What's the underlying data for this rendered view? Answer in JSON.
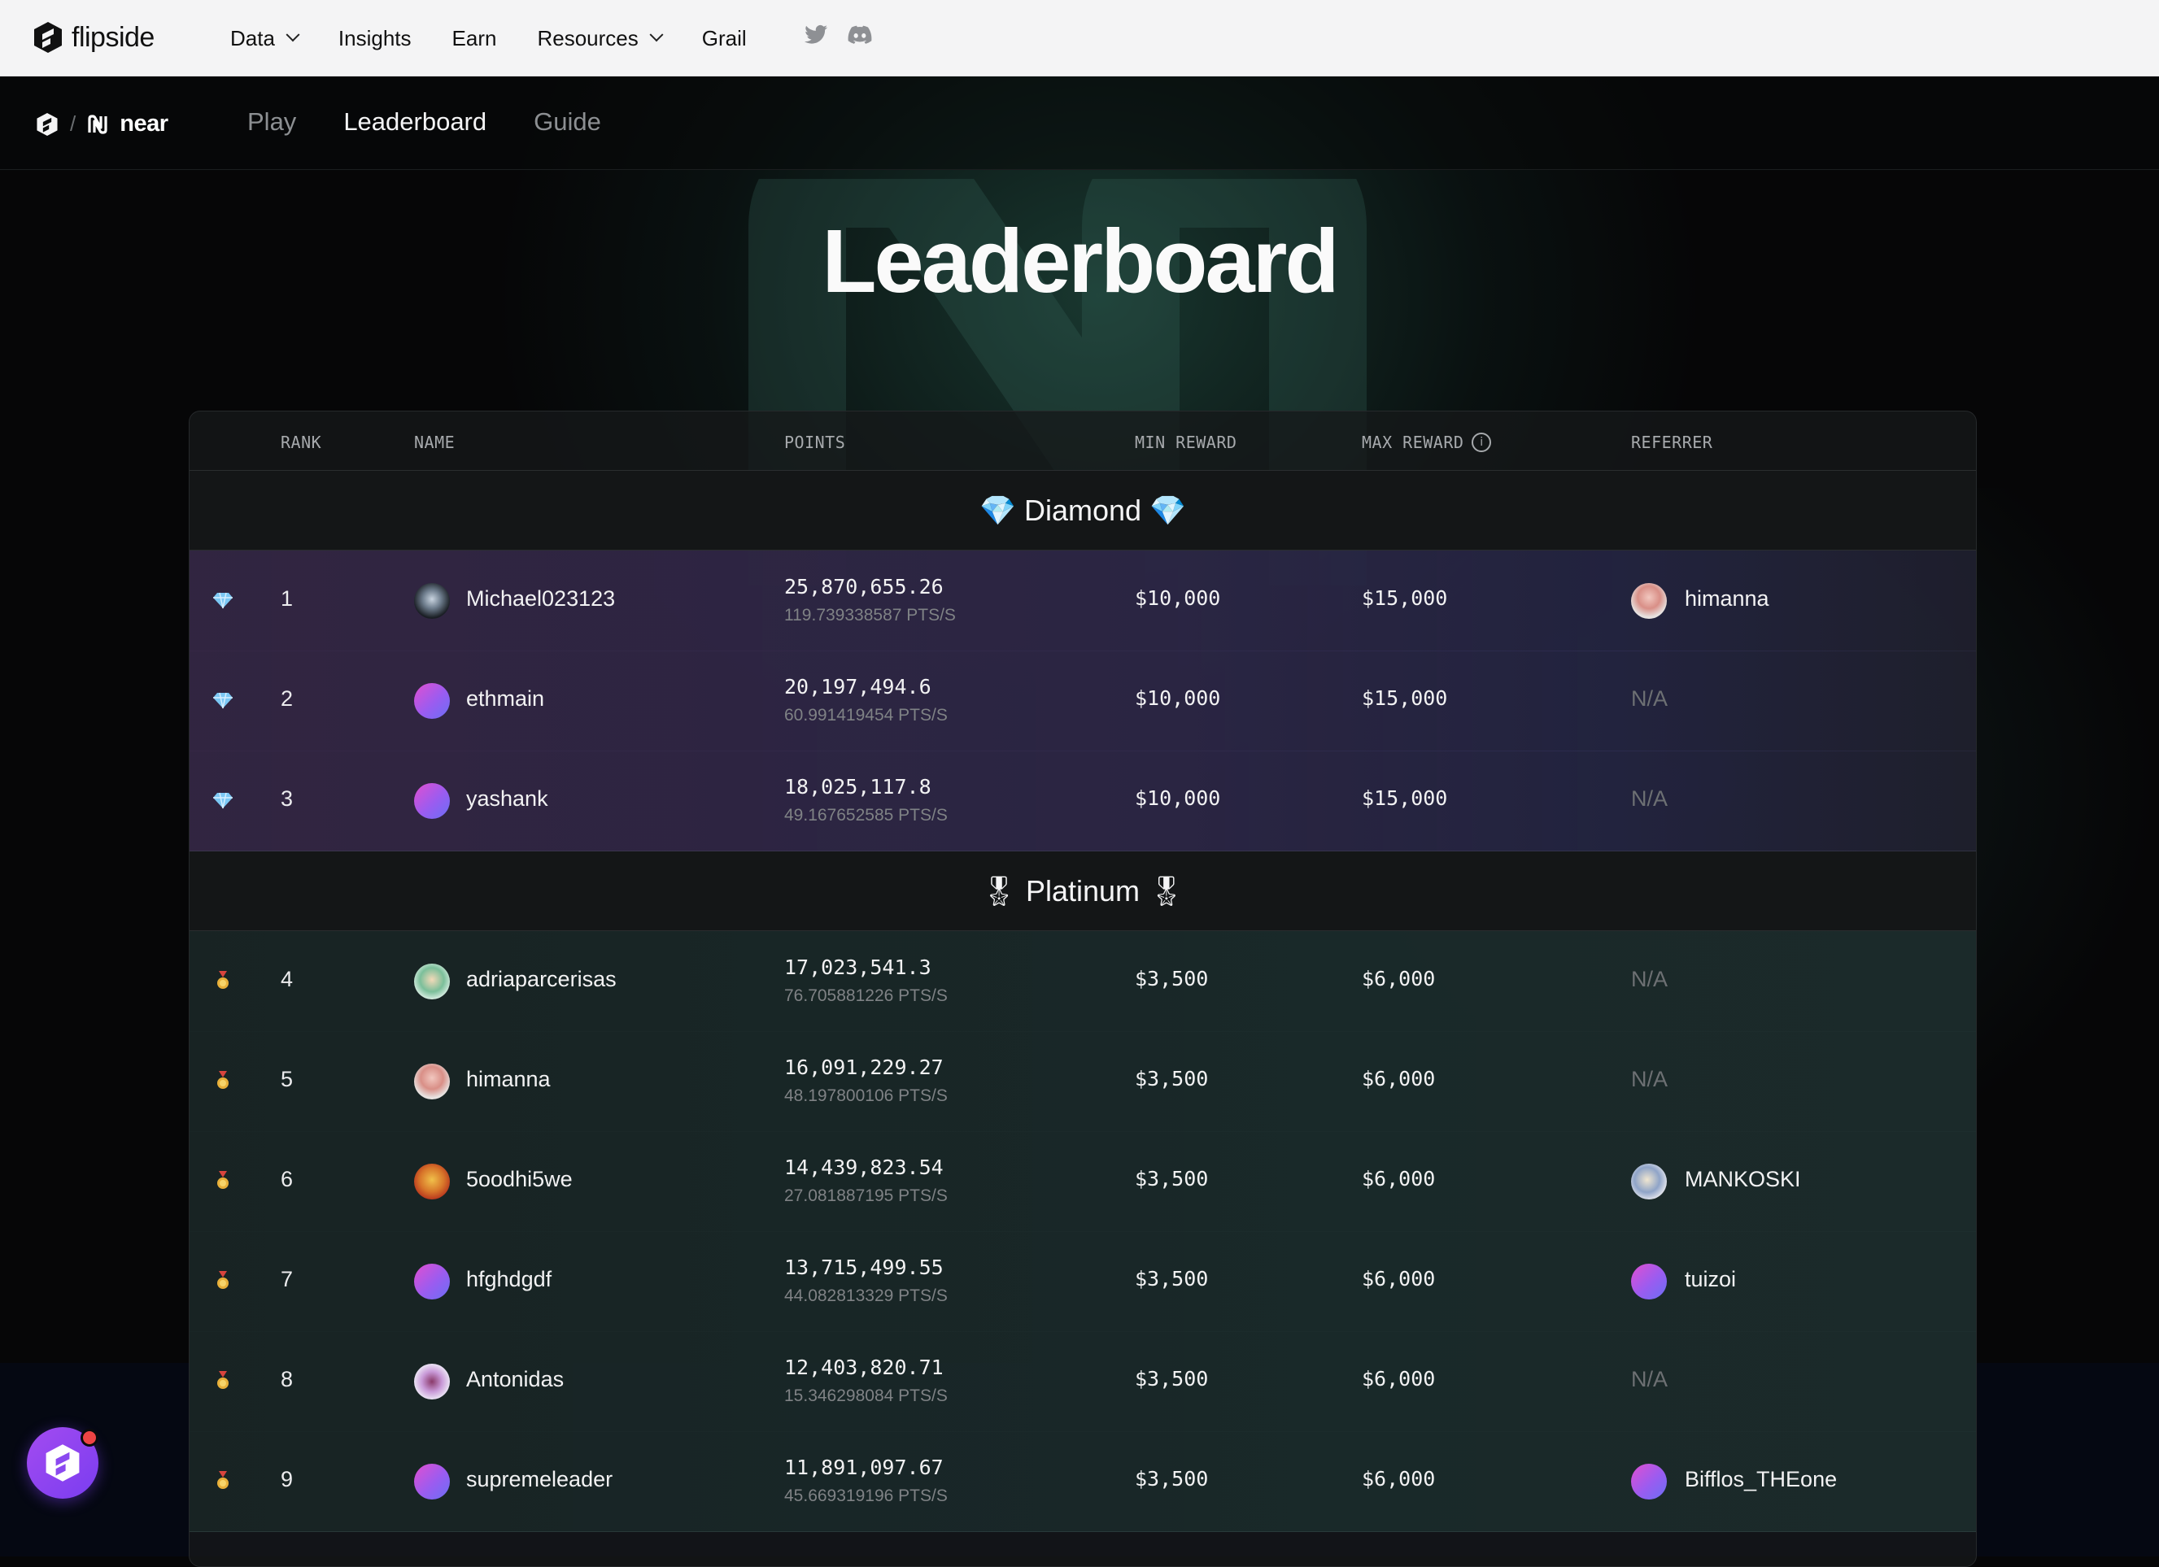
{
  "topnav": {
    "brand": "flipside",
    "menu": [
      {
        "label": "Data",
        "dropdown": true
      },
      {
        "label": "Insights",
        "dropdown": false
      },
      {
        "label": "Earn",
        "dropdown": false
      },
      {
        "label": "Resources",
        "dropdown": true
      },
      {
        "label": "Grail",
        "dropdown": false
      }
    ],
    "social": [
      "twitter-icon",
      "discord-icon"
    ]
  },
  "subnav": {
    "separator": "/",
    "partner": "near",
    "tabs": [
      {
        "label": "Play",
        "active": false
      },
      {
        "label": "Leaderboard",
        "active": true
      },
      {
        "label": "Guide",
        "active": false
      }
    ]
  },
  "page_title": "Leaderboard",
  "table": {
    "columns": {
      "rank": "RANK",
      "name": "NAME",
      "points": "POINTS",
      "min_reward": "MIN REWARD",
      "max_reward": "MAX REWARD",
      "referrer": "REFERRER"
    },
    "tiers": [
      {
        "name": "Diamond",
        "emoji": "💎",
        "rows": [
          {
            "rank": "1",
            "name": "Michael023123",
            "points": "25,870,655.26",
            "rate": "119.739338587 PTS/S",
            "min": "$10,000",
            "max": "$15,000",
            "referrer": "himanna"
          },
          {
            "rank": "2",
            "name": "ethmain",
            "points": "20,197,494.6",
            "rate": "60.991419454 PTS/S",
            "min": "$10,000",
            "max": "$15,000",
            "referrer": "N/A"
          },
          {
            "rank": "3",
            "name": "yashank",
            "points": "18,025,117.8",
            "rate": "49.167652585 PTS/S",
            "min": "$10,000",
            "max": "$15,000",
            "referrer": "N/A"
          }
        ]
      },
      {
        "name": "Platinum",
        "emoji": "🎖",
        "rows": [
          {
            "rank": "4",
            "name": "adriaparcerisas",
            "points": "17,023,541.3",
            "rate": "76.705881226 PTS/S",
            "min": "$3,500",
            "max": "$6,000",
            "referrer": "N/A"
          },
          {
            "rank": "5",
            "name": "himanna",
            "points": "16,091,229.27",
            "rate": "48.197800106 PTS/S",
            "min": "$3,500",
            "max": "$6,000",
            "referrer": "N/A"
          },
          {
            "rank": "6",
            "name": "5oodhi5we",
            "points": "14,439,823.54",
            "rate": "27.081887195 PTS/S",
            "min": "$3,500",
            "max": "$6,000",
            "referrer": "MANKOSKI"
          },
          {
            "rank": "7",
            "name": "hfghdgdf",
            "points": "13,715,499.55",
            "rate": "44.082813329 PTS/S",
            "min": "$3,500",
            "max": "$6,000",
            "referrer": "tuizoi"
          },
          {
            "rank": "8",
            "name": "Antonidas",
            "points": "12,403,820.71",
            "rate": "15.346298084 PTS/S",
            "min": "$3,500",
            "max": "$6,000",
            "referrer": "N/A"
          },
          {
            "rank": "9",
            "name": "supremeleader",
            "points": "11,891,097.67",
            "rate": "45.669319196 PTS/S",
            "min": "$3,500",
            "max": "$6,000",
            "referrer": "Bifflos_THEone"
          }
        ]
      }
    ]
  },
  "colors": {
    "accent": "#8b5cf6",
    "diamond_row": "#34264a",
    "platinum_row": "#1a2a2a",
    "notification": "#ef4444"
  }
}
